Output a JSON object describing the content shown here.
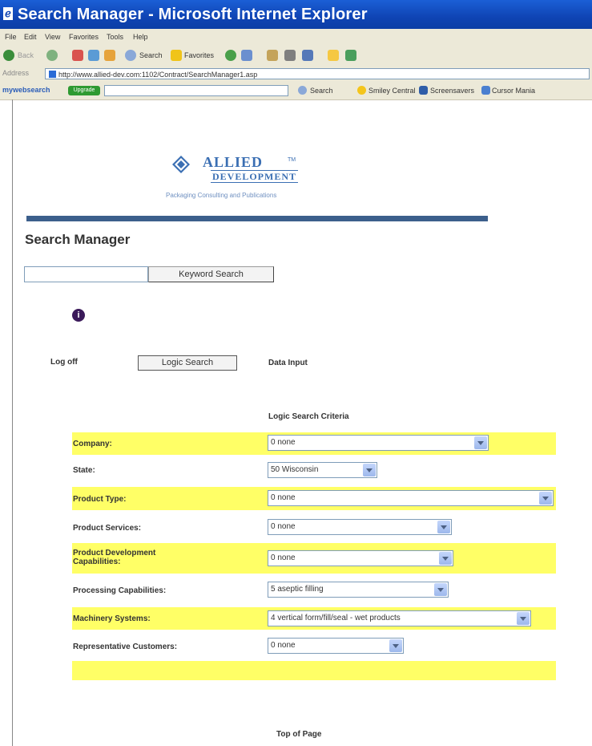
{
  "window": {
    "title": "Search Manager - Microsoft Internet Explorer"
  },
  "menu": [
    "File",
    "Edit",
    "View",
    "Favorites",
    "Tools",
    "Help"
  ],
  "toolbar": {
    "back": "Back",
    "search": "Search",
    "favorites": "Favorites"
  },
  "address": {
    "label": "Address",
    "url": "http://www.allied-dev.com:1102/Contract/SearchManager1.asp"
  },
  "websearch": {
    "brand": "mywebsearch",
    "upgrade": "Upgrade",
    "search": "Search",
    "smiley": "Smiley Central",
    "screensavers": "Screensavers",
    "cursor": "Cursor Mania"
  },
  "logo": {
    "name_top": "ALLIED",
    "name_bottom": "DEVELOPMENT",
    "tm": "TM",
    "tagline": "Packaging Consulting and Publications"
  },
  "page": {
    "heading": "Search Manager",
    "keyword_button": "Keyword Search",
    "log_off": "Log off",
    "logic_search_button": "Logic Search",
    "data_input": "Data Input",
    "criteria_title": "Logic Search Criteria",
    "top_of_page": "Top of Page"
  },
  "criteria": [
    {
      "label": "Company:",
      "value": "0 none"
    },
    {
      "label": "State:",
      "value": "50 Wisconsin"
    },
    {
      "label": "Product Type:",
      "value": "0 none"
    },
    {
      "label": "Product Services:",
      "value": "0 none"
    },
    {
      "label": "Product Development Capabilities:",
      "value": "0 none"
    },
    {
      "label": "Processing Capabilities:",
      "value": "5 aseptic filling"
    },
    {
      "label": "Machinery Systems:",
      "value": "4 vertical form/fill/seal - wet products"
    },
    {
      "label": "Representative Customers:",
      "value": "0 none"
    }
  ],
  "colors": {
    "highlight_row": "#ffff66",
    "title_bar": "#0f44b4",
    "brand_blue": "#3b6fb3",
    "rule": "#3c5f8c"
  }
}
